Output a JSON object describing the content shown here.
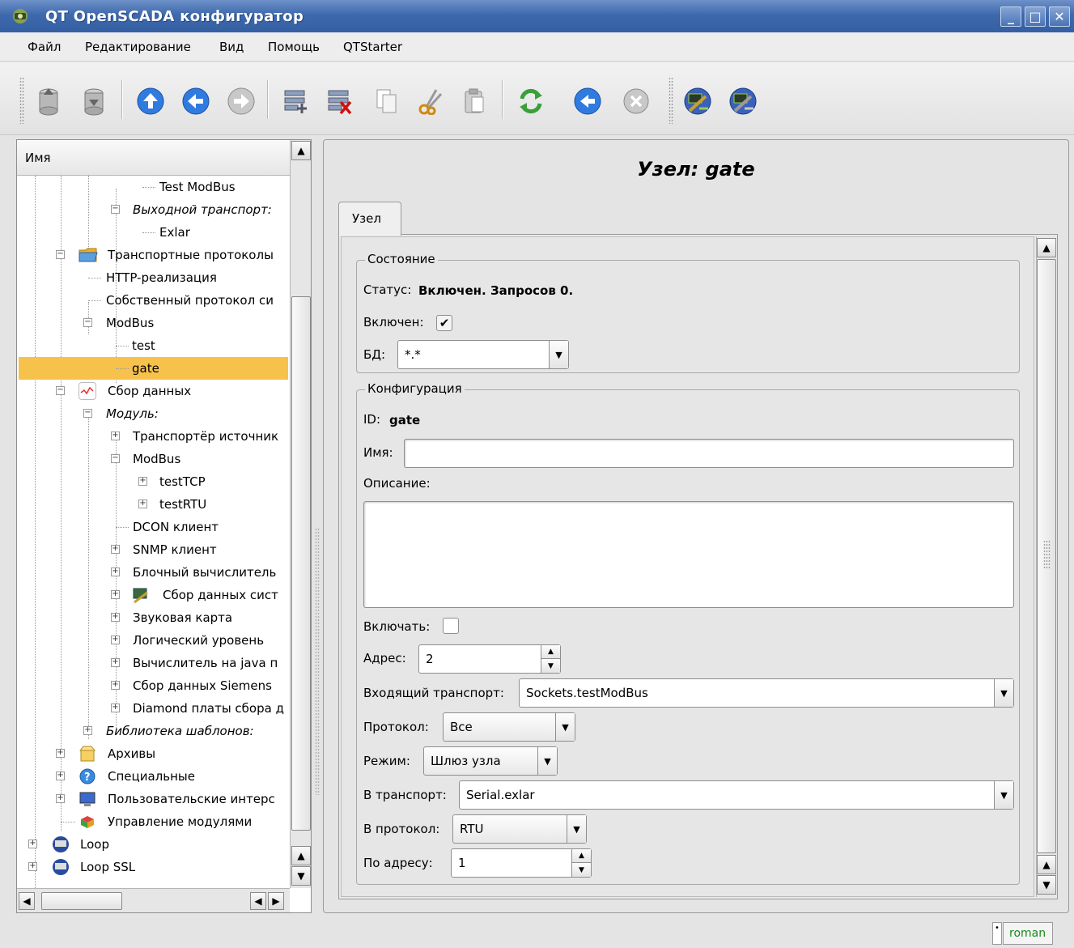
{
  "window": {
    "title": "QT OpenSCADA конфигуратор"
  },
  "menu": [
    "Файл",
    "Редактирование",
    "Вид",
    "Помощь",
    "QTStarter"
  ],
  "toolbar": {
    "buttons": [
      "db-load-icon",
      "db-save-icon",
      "up-icon",
      "back-icon",
      "forward-icon",
      "add-item-icon",
      "delete-item-icon",
      "copy-icon",
      "cut-icon",
      "paste-icon",
      "refresh-icon",
      "start-icon",
      "stop-icon",
      "connect-icon",
      "disconnect-icon"
    ]
  },
  "tree": {
    "header": "Имя",
    "rows": [
      {
        "label": "Test ModBus",
        "italic": false
      },
      {
        "label": "Выходной транспорт:",
        "italic": true
      },
      {
        "label": "Exlar",
        "italic": false
      },
      {
        "label": "Транспортные протоколы",
        "italic": false
      },
      {
        "label": "HTTP-реализация",
        "italic": false
      },
      {
        "label": "Собственный протокол си",
        "italic": false
      },
      {
        "label": "ModBus",
        "italic": false
      },
      {
        "label": "test",
        "italic": false
      },
      {
        "label": "gate",
        "italic": false,
        "selected": true
      },
      {
        "label": "Сбор данных",
        "italic": false
      },
      {
        "label": "Модуль:",
        "italic": true
      },
      {
        "label": "Транспортёр источник",
        "italic": false
      },
      {
        "label": "ModBus",
        "italic": false
      },
      {
        "label": "testTCP",
        "italic": false
      },
      {
        "label": "testRTU",
        "italic": false
      },
      {
        "label": "DCON клиент",
        "italic": false
      },
      {
        "label": "SNMP клиент",
        "italic": false
      },
      {
        "label": "Блочный вычислитель",
        "italic": false
      },
      {
        "label": "Сбор данных сист",
        "italic": false
      },
      {
        "label": "Звуковая карта",
        "italic": false
      },
      {
        "label": "Логический уровень",
        "italic": false
      },
      {
        "label": "Вычислитель на java п",
        "italic": false
      },
      {
        "label": "Сбор данных Siemens",
        "italic": false
      },
      {
        "label": "Diamond платы сбора д",
        "italic": false
      },
      {
        "label": "Библиотека шаблонов:",
        "italic": true
      },
      {
        "label": "Архивы",
        "italic": false
      },
      {
        "label": "Специальные",
        "italic": false
      },
      {
        "label": "Пользовательские интерс",
        "italic": false
      },
      {
        "label": "Управление модулями",
        "italic": false
      },
      {
        "label": "Loop",
        "italic": false
      },
      {
        "label": "Loop SSL",
        "italic": false
      }
    ]
  },
  "node": {
    "title": "Узел: gate",
    "tab": "Узел",
    "state": {
      "group_title": "Состояние",
      "status_label": "Статус:",
      "status_value": "Включен. Запросов 0.",
      "enabled_label": "Включен:",
      "enabled": true,
      "db_label": "БД:",
      "db_value": "*.*"
    },
    "config": {
      "group_title": "Конфигурация",
      "id_label": "ID:",
      "id_value": "gate",
      "name_label": "Имя:",
      "name_value": "",
      "descr_label": "Описание:",
      "descr_value": "",
      "enable_label": "Включать:",
      "enable": false,
      "addr_label": "Адрес:",
      "addr_value": "2",
      "in_transport_label": "Входящий транспорт:",
      "in_transport_value": "Sockets.testModBus",
      "protocol_label": "Протокол:",
      "protocol_value": "Все",
      "mode_label": "Режим:",
      "mode_value": "Шлюз узла",
      "to_transport_label": "В транспорт:",
      "to_transport_value": "Serial.exlar",
      "to_protocol_label": "В протокол:",
      "to_protocol_value": "RTU",
      "to_addr_label": "По адресу:",
      "to_addr_value": "1"
    }
  },
  "status_bar": {
    "user": "roman"
  },
  "colors": {
    "titlebar": "#3e69ad",
    "selection": "#f6c24c",
    "user_text": "#1a8a1a"
  }
}
